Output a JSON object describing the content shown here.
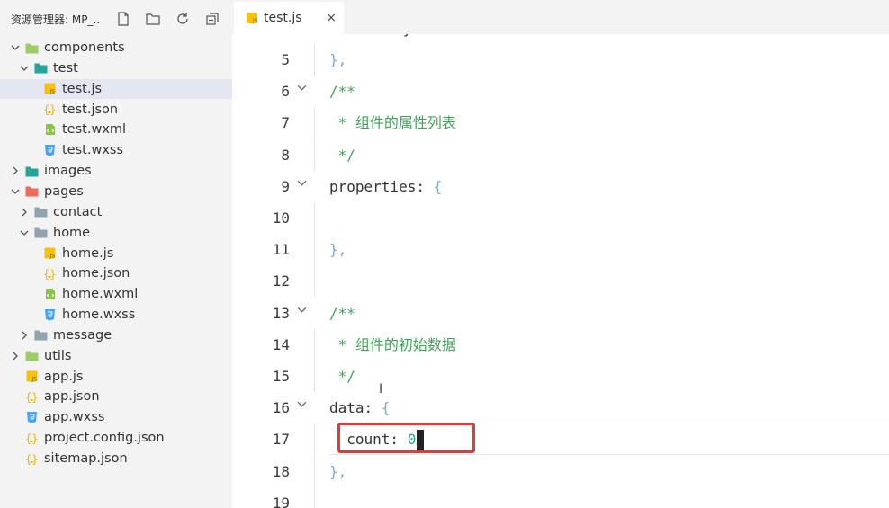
{
  "sidebar": {
    "title": "资源管理器: MP_...",
    "items": [
      {
        "label": "components",
        "depth": 0,
        "chevron": "down",
        "icon": "components-folder-icon",
        "color": "#9ccc65"
      },
      {
        "label": "test",
        "depth": 1,
        "chevron": "down",
        "icon": "folder-open-icon",
        "color": "#26a69a"
      },
      {
        "label": "test.js",
        "depth": 2,
        "chevron": "none",
        "icon": "js-file-icon",
        "color": "#f4c20d",
        "selected": true
      },
      {
        "label": "test.json",
        "depth": 2,
        "chevron": "none",
        "icon": "json-file-icon",
        "color": "#f4b400"
      },
      {
        "label": "test.wxml",
        "depth": 2,
        "chevron": "none",
        "icon": "wxml-file-icon",
        "color": "#8bc34a"
      },
      {
        "label": "test.wxss",
        "depth": 2,
        "chevron": "none",
        "icon": "wxss-file-icon",
        "color": "#42a5f5"
      },
      {
        "label": "images",
        "depth": 0,
        "chevron": "right",
        "icon": "images-folder-icon",
        "color": "#26a69a"
      },
      {
        "label": "pages",
        "depth": 0,
        "chevron": "down",
        "icon": "pages-folder-icon",
        "color": "#ef6c57"
      },
      {
        "label": "contact",
        "depth": 1,
        "chevron": "right",
        "icon": "folder-icon",
        "color": "#90a4ae"
      },
      {
        "label": "home",
        "depth": 1,
        "chevron": "down",
        "icon": "folder-open-icon",
        "color": "#90a4ae"
      },
      {
        "label": "home.js",
        "depth": 2,
        "chevron": "none",
        "icon": "js-file-icon",
        "color": "#f4c20d"
      },
      {
        "label": "home.json",
        "depth": 2,
        "chevron": "none",
        "icon": "json-file-icon",
        "color": "#f4b400"
      },
      {
        "label": "home.wxml",
        "depth": 2,
        "chevron": "none",
        "icon": "wxml-file-icon",
        "color": "#8bc34a"
      },
      {
        "label": "home.wxss",
        "depth": 2,
        "chevron": "none",
        "icon": "wxss-file-icon",
        "color": "#42a5f5"
      },
      {
        "label": "message",
        "depth": 1,
        "chevron": "right",
        "icon": "folder-icon",
        "color": "#90a4ae"
      },
      {
        "label": "utils",
        "depth": 0,
        "chevron": "right",
        "icon": "utils-folder-icon",
        "color": "#9ccc65"
      },
      {
        "label": "app.js",
        "depth": 0,
        "chevron": "none",
        "icon": "js-file-icon",
        "color": "#f4c20d"
      },
      {
        "label": "app.json",
        "depth": 0,
        "chevron": "none",
        "icon": "json-file-icon",
        "color": "#f4b400"
      },
      {
        "label": "app.wxss",
        "depth": 0,
        "chevron": "none",
        "icon": "wxss-file-icon",
        "color": "#42a5f5"
      },
      {
        "label": "project.config.json",
        "depth": 0,
        "chevron": "none",
        "icon": "json-file-icon",
        "color": "#f4b400"
      },
      {
        "label": "sitemap.json",
        "depth": 0,
        "chevron": "none",
        "icon": "json-file-icon",
        "color": "#f4b400"
      }
    ]
  },
  "tab": {
    "label": "test.js",
    "close": "×"
  },
  "editor": {
    "top_partial": "y",
    "lines": [
      {
        "num": "5",
        "fold": false,
        "tokens": [
          [
            "brace",
            "},"
          ]
        ]
      },
      {
        "num": "6",
        "fold": true,
        "tokens": [
          [
            "comment",
            "/**"
          ]
        ]
      },
      {
        "num": "7",
        "fold": false,
        "tokens": [
          [
            "comment",
            " * "
          ],
          [
            "comment-cn",
            "组件的属性列表"
          ]
        ]
      },
      {
        "num": "8",
        "fold": false,
        "tokens": [
          [
            "comment",
            " */"
          ]
        ]
      },
      {
        "num": "9",
        "fold": true,
        "tokens": [
          [
            "key",
            "properties: "
          ],
          [
            "brace",
            "{"
          ]
        ]
      },
      {
        "num": "10",
        "fold": false,
        "tokens": []
      },
      {
        "num": "11",
        "fold": false,
        "tokens": [
          [
            "brace",
            "},"
          ]
        ]
      },
      {
        "num": "12",
        "fold": false,
        "tokens": []
      },
      {
        "num": "13",
        "fold": true,
        "tokens": [
          [
            "comment",
            "/**"
          ]
        ]
      },
      {
        "num": "14",
        "fold": false,
        "tokens": [
          [
            "comment",
            " * "
          ],
          [
            "comment-cn",
            "组件的初始数据"
          ]
        ]
      },
      {
        "num": "15",
        "fold": false,
        "tokens": [
          [
            "comment",
            " */"
          ]
        ]
      },
      {
        "num": "16",
        "fold": true,
        "tokens": [
          [
            "key",
            "data: "
          ],
          [
            "brace",
            "{"
          ]
        ]
      },
      {
        "num": "17",
        "fold": false,
        "tokens": [
          [
            "key",
            "  count: "
          ],
          [
            "num",
            "0"
          ]
        ],
        "cursor": true
      },
      {
        "num": "18",
        "fold": false,
        "tokens": [
          [
            "brace",
            "},"
          ]
        ]
      },
      {
        "num": "19",
        "fold": false,
        "tokens": []
      }
    ]
  }
}
